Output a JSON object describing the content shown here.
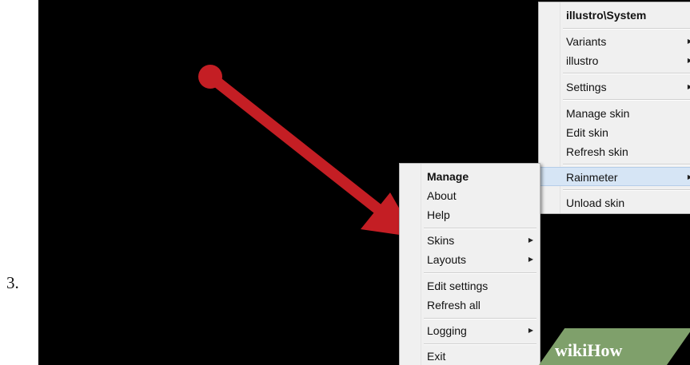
{
  "step_number": "3.",
  "watermark": {
    "wiki": "wiki",
    "how": "How"
  },
  "skin_menu": {
    "title": "illustro\\System",
    "items": [
      {
        "label": "Variants",
        "submenu": true
      },
      {
        "label": "illustro",
        "submenu": true
      },
      {
        "label": "Settings",
        "submenu": true
      },
      {
        "label": "Manage skin",
        "submenu": false
      },
      {
        "label": "Edit skin",
        "submenu": false
      },
      {
        "label": "Refresh skin",
        "submenu": false
      },
      {
        "label": "Rainmeter",
        "submenu": true,
        "highlighted": true
      },
      {
        "label": "Unload skin",
        "submenu": false
      }
    ]
  },
  "tray_menu": {
    "items": [
      {
        "label": "Manage",
        "bold": true,
        "submenu": false
      },
      {
        "label": "About",
        "submenu": false
      },
      {
        "label": "Help",
        "submenu": false
      },
      {
        "label": "Skins",
        "submenu": true
      },
      {
        "label": "Layouts",
        "submenu": true
      },
      {
        "label": "Edit settings",
        "submenu": false
      },
      {
        "label": "Refresh all",
        "submenu": false
      },
      {
        "label": "Logging",
        "submenu": true
      },
      {
        "label": "Exit",
        "submenu": false
      }
    ]
  },
  "arrow_color": "#c41e24",
  "submenu_icon": "triangle-right-icon"
}
